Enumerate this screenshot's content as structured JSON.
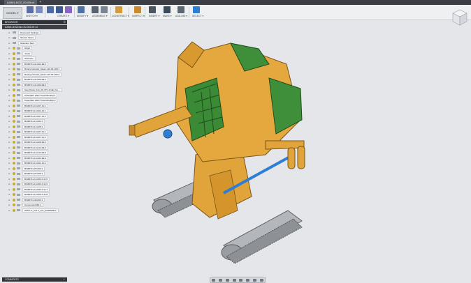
{
  "document_tab": {
    "title": "A2861-BOZ_00-0B v4"
  },
  "toolbar": {
    "workspace": "MODEL ▾",
    "groups": [
      "SKETCH ▾",
      "CREATE ▾",
      "MODIFY ▾",
      "ASSEMBLE ▾",
      "CONSTRUCT ▾",
      "INSPECT ▾",
      "INSERT ▾",
      "MAKE ▾",
      "ADD-INS ▾",
      "SELECT ▾"
    ]
  },
  "browser": {
    "title": "BROWSER",
    "root": "A2861-BOZ2310-00-000-0E v4",
    "items": [
      {
        "label": "Document Settings",
        "icon": "gear-icon",
        "eye": false
      },
      {
        "label": "Named Views",
        "icon": "folder-icon",
        "eye": false
      },
      {
        "label": "Selection Sets",
        "icon": "folder-icon",
        "eye": false
      },
      {
        "label": "Origin",
        "icon": "folder-icon",
        "eye": true
      },
      {
        "label": "Joints",
        "icon": "folder-icon",
        "eye": true
      },
      {
        "label": "Sketches",
        "icon": "folder-icon",
        "eye": true
      },
      {
        "label": "BOZ0711-41-001-0E:1",
        "icon": "component-icon",
        "eye": true
      },
      {
        "label": "Rotary Actuator_Mean L20-30-100:1",
        "icon": "component-icon",
        "eye": true
      },
      {
        "label": "Rotary Actuator_Mean L20-30-100:2",
        "icon": "component-icon",
        "eye": true
      },
      {
        "label": "BOZ0711-41-009-0E:1",
        "icon": "component-icon",
        "eye": true
      },
      {
        "label": "BOZ0711-41-009-0E:2",
        "icon": "component-icon",
        "eye": true
      },
      {
        "label": "Gas Piston Unit_20-YP-13-GE_Fre...",
        "icon": "component-icon",
        "eye": true
      },
      {
        "label": "Caterpiller 200x Tread Workup:1",
        "icon": "component-icon",
        "eye": true
      },
      {
        "label": "Caterpiller 200x Tread Workup:2",
        "icon": "component-icon",
        "eye": true
      },
      {
        "label": "BOZ0711-13-007-11:1",
        "icon": "component-icon",
        "eye": true
      },
      {
        "label": "BOZ0711-13-004-11:1",
        "icon": "component-icon",
        "eye": true
      },
      {
        "label": "BOZ0711-13-007-11:2",
        "icon": "component-icon",
        "eye": true
      },
      {
        "label": "BOZ0711-13-002:1",
        "icon": "component-icon",
        "eye": true
      },
      {
        "label": "BOZ0711-13-025:1",
        "icon": "component-icon",
        "eye": true
      },
      {
        "label": "BOZ0711-13-027-11:1",
        "icon": "component-icon",
        "eye": true
      },
      {
        "label": "BOZ0711-13-027-11:2",
        "icon": "component-icon",
        "eye": true
      },
      {
        "label": "BOZ0711-13-008-0E:1",
        "icon": "component-icon",
        "eye": true
      },
      {
        "label": "BOZ0711-13-012-0E:1",
        "icon": "component-icon",
        "eye": true
      },
      {
        "label": "BOZ0711-13-012-0E:2",
        "icon": "component-icon",
        "eye": true
      },
      {
        "label": "BOZ0711-13-024-0E:1",
        "icon": "component-icon",
        "eye": true
      },
      {
        "label": "BOZ0711-13-004-11:2",
        "icon": "component-icon",
        "eye": true
      },
      {
        "label": "BOZ0711-25-004:1",
        "icon": "component-icon",
        "eye": true
      },
      {
        "label": "BOZ0711-26-006:1",
        "icon": "component-icon",
        "eye": true
      },
      {
        "label": "BOZ0711-13-003-0 11:5",
        "icon": "component-icon",
        "eye": true
      },
      {
        "label": "BOZ0711-13-003-0 11:6",
        "icon": "component-icon",
        "eye": true
      },
      {
        "label": "BOZ0711-13-003-0 11:7",
        "icon": "component-icon",
        "eye": true
      },
      {
        "label": "BOZ0711-13-003-0 11:8",
        "icon": "component-icon",
        "eye": true
      },
      {
        "label": "BOZ0711-40-002:1",
        "icon": "component-icon",
        "eye": true
      },
      {
        "label": "Component462:1",
        "icon": "component-icon",
        "eye": true
      },
      {
        "label": "AN5-1-1_2x1-1_2x1_01000000:1",
        "icon": "component-icon",
        "eye": true
      }
    ]
  },
  "comments": {
    "title": "COMMENTS"
  },
  "colors": {
    "accent_blue": "#2e7fd3",
    "body_orange": "#e0a43a",
    "armor_green": "#3f8f3a",
    "track_grey": "#8c8f93"
  }
}
